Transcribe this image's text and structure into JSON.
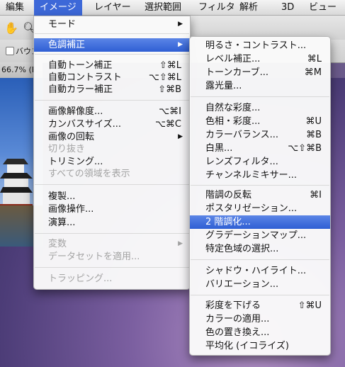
{
  "menubar": {
    "items": [
      {
        "label": "編集"
      },
      {
        "label": "イメージ",
        "active": true
      },
      {
        "label": "レイヤー"
      },
      {
        "label": "選択範囲"
      },
      {
        "label": "フィルタ"
      },
      {
        "label": "解析"
      },
      {
        "label": "3D"
      },
      {
        "label": "ビュー"
      }
    ]
  },
  "options": {
    "checkbox_label": "バウン",
    "zoom_label": "66.7% (F"
  },
  "image_menu": {
    "items": [
      {
        "label": "モード",
        "submenu": true
      },
      {
        "label": "色調補正",
        "submenu": true,
        "highlighted": true
      },
      {
        "label": "自動トーン補正",
        "shortcut": "⇧⌘L"
      },
      {
        "label": "自動コントラスト",
        "shortcut": "⌥⇧⌘L"
      },
      {
        "label": "自動カラー補正",
        "shortcut": "⇧⌘B"
      },
      {
        "label": "画像解像度...",
        "shortcut": "⌥⌘I"
      },
      {
        "label": "カンバスサイズ...",
        "shortcut": "⌥⌘C"
      },
      {
        "label": "画像の回転",
        "submenu": true
      },
      {
        "label": "切り抜き",
        "disabled": true
      },
      {
        "label": "トリミング..."
      },
      {
        "label": "すべての領域を表示",
        "disabled": true
      },
      {
        "label": "複製..."
      },
      {
        "label": "画像操作..."
      },
      {
        "label": "演算..."
      },
      {
        "label": "変数",
        "submenu": true,
        "disabled": true
      },
      {
        "label": "データセットを適用...",
        "disabled": true
      },
      {
        "label": "トラッピング...",
        "disabled": true
      }
    ]
  },
  "adjustments_menu": {
    "items": [
      {
        "label": "明るさ・コントラスト..."
      },
      {
        "label": "レベル補正...",
        "shortcut": "⌘L"
      },
      {
        "label": "トーンカーブ...",
        "shortcut": "⌘M"
      },
      {
        "label": "露光量..."
      },
      {
        "label": "自然な彩度..."
      },
      {
        "label": "色相・彩度...",
        "shortcut": "⌘U"
      },
      {
        "label": "カラーバランス...",
        "shortcut": "⌘B"
      },
      {
        "label": "白黒...",
        "shortcut": "⌥⇧⌘B"
      },
      {
        "label": "レンズフィルタ..."
      },
      {
        "label": "チャンネルミキサー..."
      },
      {
        "label": "階調の反転",
        "shortcut": "⌘I"
      },
      {
        "label": "ポスタリゼーション..."
      },
      {
        "label": "2 階調化...",
        "highlighted": true
      },
      {
        "label": "グラデーションマップ..."
      },
      {
        "label": "特定色域の選択..."
      },
      {
        "label": "シャドウ・ハイライト..."
      },
      {
        "label": "バリエーション..."
      },
      {
        "label": "彩度を下げる",
        "shortcut": "⇧⌘U"
      },
      {
        "label": "カラーの適用..."
      },
      {
        "label": "色の置き換え..."
      },
      {
        "label": "平均化 (イコライズ)"
      }
    ]
  }
}
